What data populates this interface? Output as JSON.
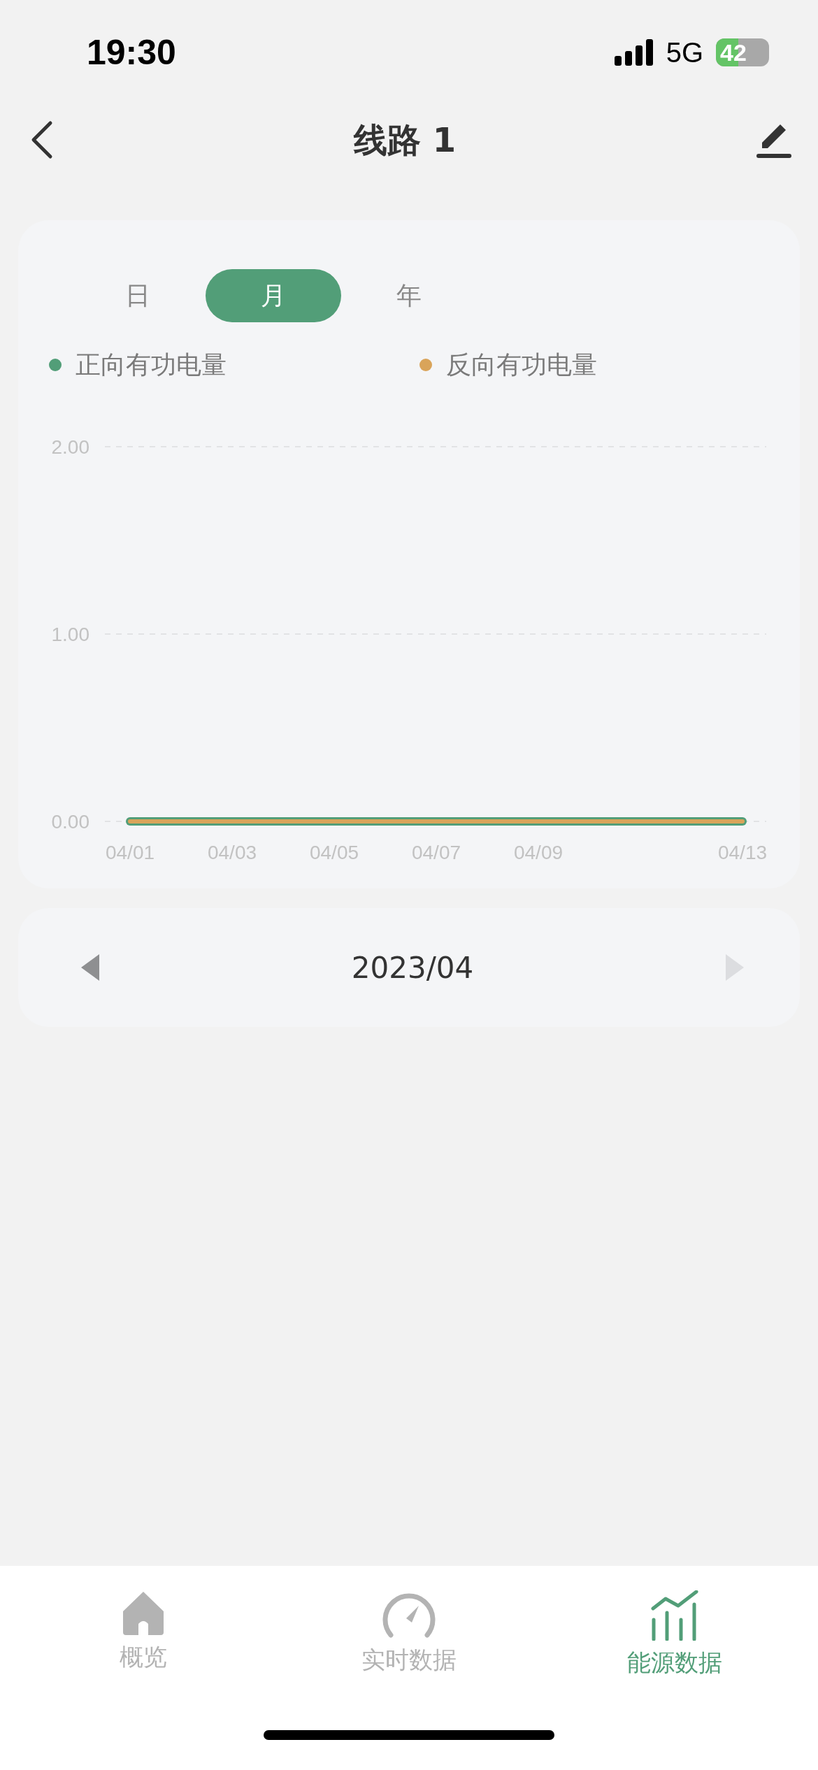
{
  "status_bar": {
    "time": "19:30",
    "network": "5G",
    "battery": "42"
  },
  "header": {
    "title": "线路 1"
  },
  "tabs": [
    {
      "label": "日",
      "selected": false
    },
    {
      "label": "月",
      "selected": true
    },
    {
      "label": "年",
      "selected": false
    }
  ],
  "chart_data": {
    "type": "line",
    "categories": [
      "04/01",
      null,
      "04/03",
      null,
      "04/05",
      null,
      "04/07",
      null,
      "04/09",
      null,
      null,
      null,
      "04/13"
    ],
    "yticks": [
      {
        "value": 0,
        "label": "0.00"
      },
      {
        "value": 1,
        "label": "1.00"
      },
      {
        "value": 2,
        "label": "2.00"
      }
    ],
    "ylim": [
      0,
      2
    ],
    "series": [
      {
        "name": "正向有功电量",
        "color": "#529e78",
        "values": [
          0,
          0,
          0,
          0,
          0,
          0,
          0,
          0,
          0,
          0,
          0,
          0,
          0
        ]
      },
      {
        "name": "反向有功电量",
        "color": "#d9a45a",
        "values": [
          0,
          0,
          0,
          0,
          0,
          0,
          0,
          0,
          0,
          0,
          0,
          0,
          0
        ]
      }
    ]
  },
  "period": {
    "label": "2023/04",
    "prev_disabled": false,
    "next_disabled": true
  },
  "bottom_nav": [
    {
      "label": "概览",
      "selected": false
    },
    {
      "label": "实时数据",
      "selected": false
    },
    {
      "label": "能源数据",
      "selected": true
    }
  ]
}
